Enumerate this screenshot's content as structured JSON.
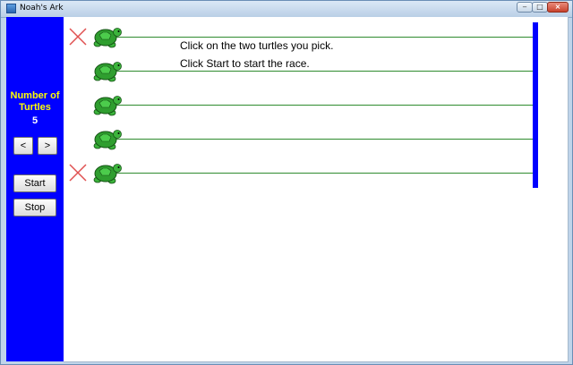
{
  "window": {
    "title": "Noah's Ark"
  },
  "sidebar": {
    "number_label": "Number of Turtles",
    "number_value": "5",
    "prev_label": "<",
    "next_label": ">",
    "start_label": "Start",
    "stop_label": "Stop"
  },
  "instructions": {
    "line1": "Click on the two turtles you pick.",
    "line2": "Click Start to start the race."
  },
  "lanes": [
    {
      "picked": true,
      "icon": "turtle-icon"
    },
    {
      "picked": false,
      "icon": "turtle-icon"
    },
    {
      "picked": false,
      "icon": "turtle-icon"
    },
    {
      "picked": false,
      "icon": "turtle-icon"
    },
    {
      "picked": true,
      "icon": "turtle-icon"
    }
  ],
  "colors": {
    "sidebar_bg": "#0000ff",
    "label_color": "#ffff00",
    "finish_line": "#0000ff",
    "lane_line": "#2e8b2e",
    "turtle": "#2f9e2f",
    "x_mark": "#e05050"
  }
}
